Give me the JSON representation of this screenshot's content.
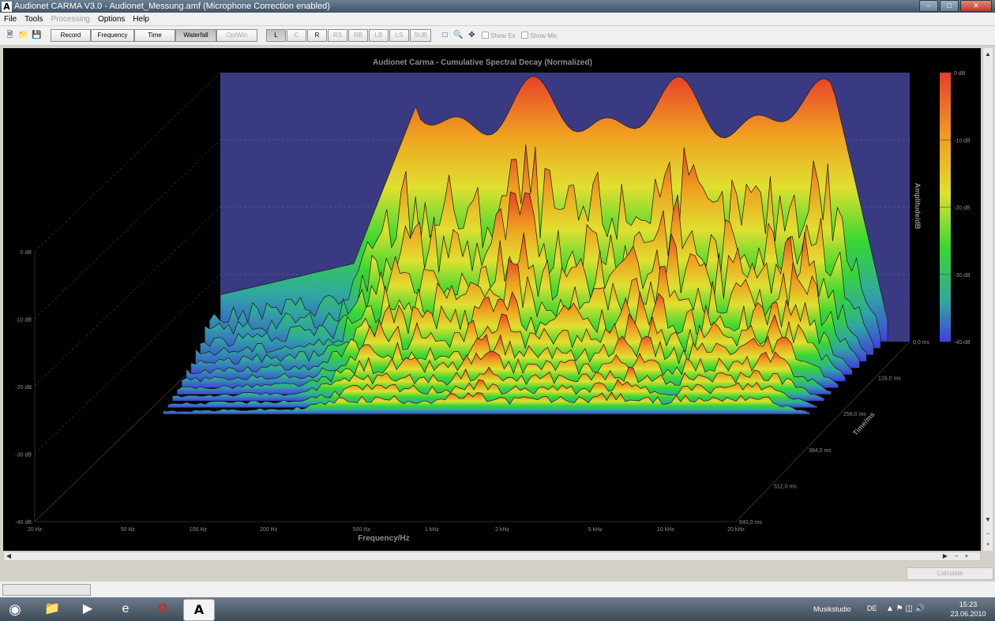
{
  "window": {
    "app_icon_letter": "A",
    "title": "Audionet CARMA V3.0 - Audionet_Messung.amf (Microphone Correction enabled)",
    "minimize_label": "–",
    "maximize_label": "□",
    "close_label": "✕"
  },
  "menu": {
    "items": [
      "File",
      "Tools",
      "Processing",
      "Options",
      "Help"
    ]
  },
  "toolbar": {
    "icons": [
      "new-file-icon",
      "open-folder-icon",
      "save-icon",
      "window-icon",
      "zoom-icon",
      "pan-move-icon"
    ],
    "record": "Record",
    "frequency": "Frequency",
    "time": "Time",
    "waterfall": "Waterfall",
    "optwin": "OptWin",
    "channels": [
      "L",
      "C",
      "R",
      "RS",
      "RB",
      "LB",
      "LS",
      "SUB"
    ],
    "show_ex": "Show Ex",
    "show_mic": "Show Mic"
  },
  "plot": {
    "title": "Audionet Carma - Cumulative Spectral Decay (Normalized)",
    "x_axis_label": "Frequency/Hz",
    "x_ticks": [
      "20 Hz",
      "50 Hz",
      "100 Hz",
      "200 Hz",
      "500 Hz",
      "1 kHz",
      "2 kHz",
      "5 kHz",
      "10 kHz",
      "20 kHz"
    ],
    "y_ticks": [
      "0 dB",
      "-10 dB",
      "-20 dB",
      "-30 dB",
      "-40 dB"
    ],
    "time_axis_label": "Time/ms",
    "time_ticks": [
      "0,0 ms",
      "128,0 ms",
      "256,0 ms",
      "384,0 ms",
      "512,0 ms",
      "640,0 ms"
    ],
    "colorbar_label": "Amplitude/dB",
    "colorbar_ticks": [
      "0 dB",
      "-10 dB",
      "-20 dB",
      "-30 dB",
      "-40 dB"
    ],
    "colors": {
      "background": "#000000",
      "plane": "#3a3a82",
      "hot": "#e8402a",
      "warm": "#f0a020",
      "mid": "#e8e030",
      "green": "#38d830",
      "cool": "#4040e0"
    }
  },
  "bottom": {
    "calculate": "Calculate"
  },
  "taskbar": {
    "apps": [
      "start-orb-icon",
      "explorer-folder-icon",
      "media-player-icon",
      "internet-explorer-icon",
      "opera-icon",
      "carma-app-icon"
    ],
    "network": "Musikstudio",
    "language": "DE",
    "time": "15:23",
    "date": "23.06.2010"
  }
}
